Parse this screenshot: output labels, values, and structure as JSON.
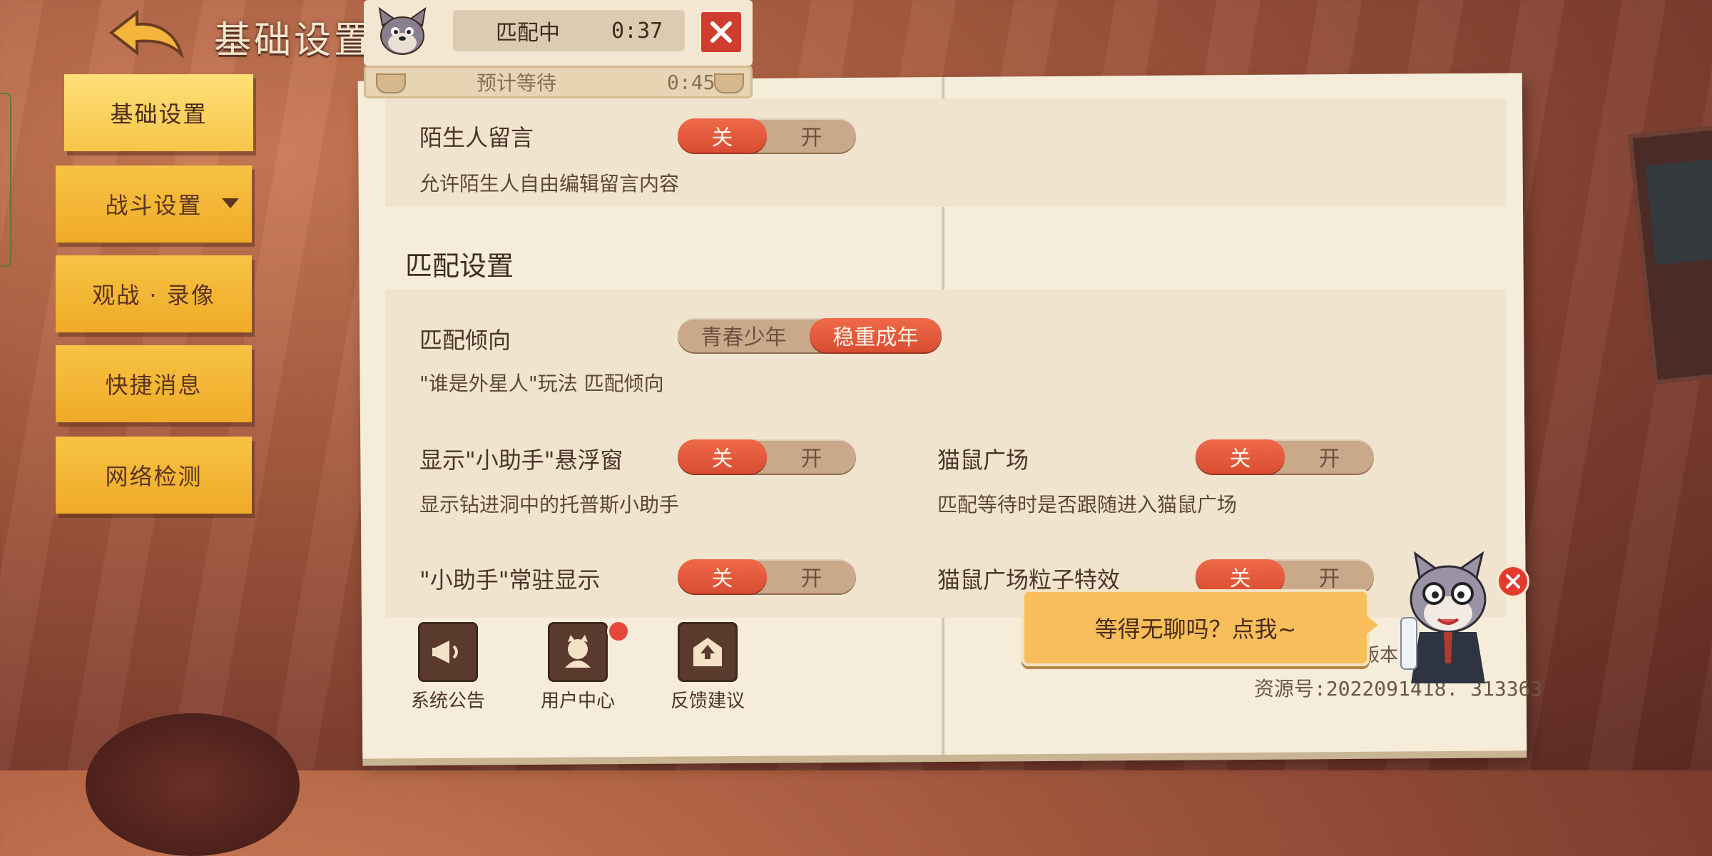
{
  "header": {
    "title": "基础设置"
  },
  "sidebar": {
    "items": [
      {
        "label": "基础设置",
        "active": true
      },
      {
        "label": "战斗设置",
        "active": false,
        "has_dropdown": true
      },
      {
        "label": "观战 · 录像",
        "active": false
      },
      {
        "label": "快捷消息",
        "active": false
      },
      {
        "label": "网络检测",
        "active": false
      }
    ]
  },
  "matchmaking": {
    "status": "匹配中",
    "elapsed": "0:37",
    "estimate_label": "预计等待",
    "estimate_time": "0:45"
  },
  "settings": {
    "stranger_message": {
      "label": "陌生人留言",
      "desc": "允许陌生人自由编辑留言内容",
      "off": "关",
      "on": "开",
      "value": "关"
    },
    "match_section_title": "匹配设置",
    "match_preference": {
      "label": "匹配倾向",
      "desc": "\"谁是外星人\"玩法 匹配倾向",
      "opt1": "青春少年",
      "opt2": "稳重成年",
      "value": "稳重成年"
    },
    "helper_float": {
      "label": "显示\"小助手\"悬浮窗",
      "desc": "显示钻进洞中的托普斯小助手",
      "off": "关",
      "on": "开",
      "value": "关"
    },
    "cat_mouse_plaza": {
      "label": "猫鼠广场",
      "desc": "匹配等待时是否跟随进入猫鼠广场",
      "off": "关",
      "on": "开",
      "value": "关"
    },
    "helper_resident": {
      "label": "\"小助手\"常驻显示",
      "off": "关",
      "on": "开",
      "value": "关"
    },
    "plaza_particles": {
      "label": "猫鼠广场粒子特效",
      "off": "关",
      "on": "开",
      "value": "关"
    }
  },
  "toolbar": {
    "items": [
      {
        "label": "系统公告",
        "icon": "megaphone-icon"
      },
      {
        "label": "用户中心",
        "icon": "user-center-icon",
        "has_badge": true
      },
      {
        "label": "反馈建议",
        "icon": "feedback-icon"
      }
    ]
  },
  "footer": {
    "version_label": "版本",
    "resource_id": "资源号:2022091418. 313363"
  },
  "popup": {
    "text": "等得无聊吗？点我~"
  },
  "colors": {
    "accent": "#e0553a",
    "sidebar": "#f3b533",
    "panel": "#f6ecda"
  }
}
